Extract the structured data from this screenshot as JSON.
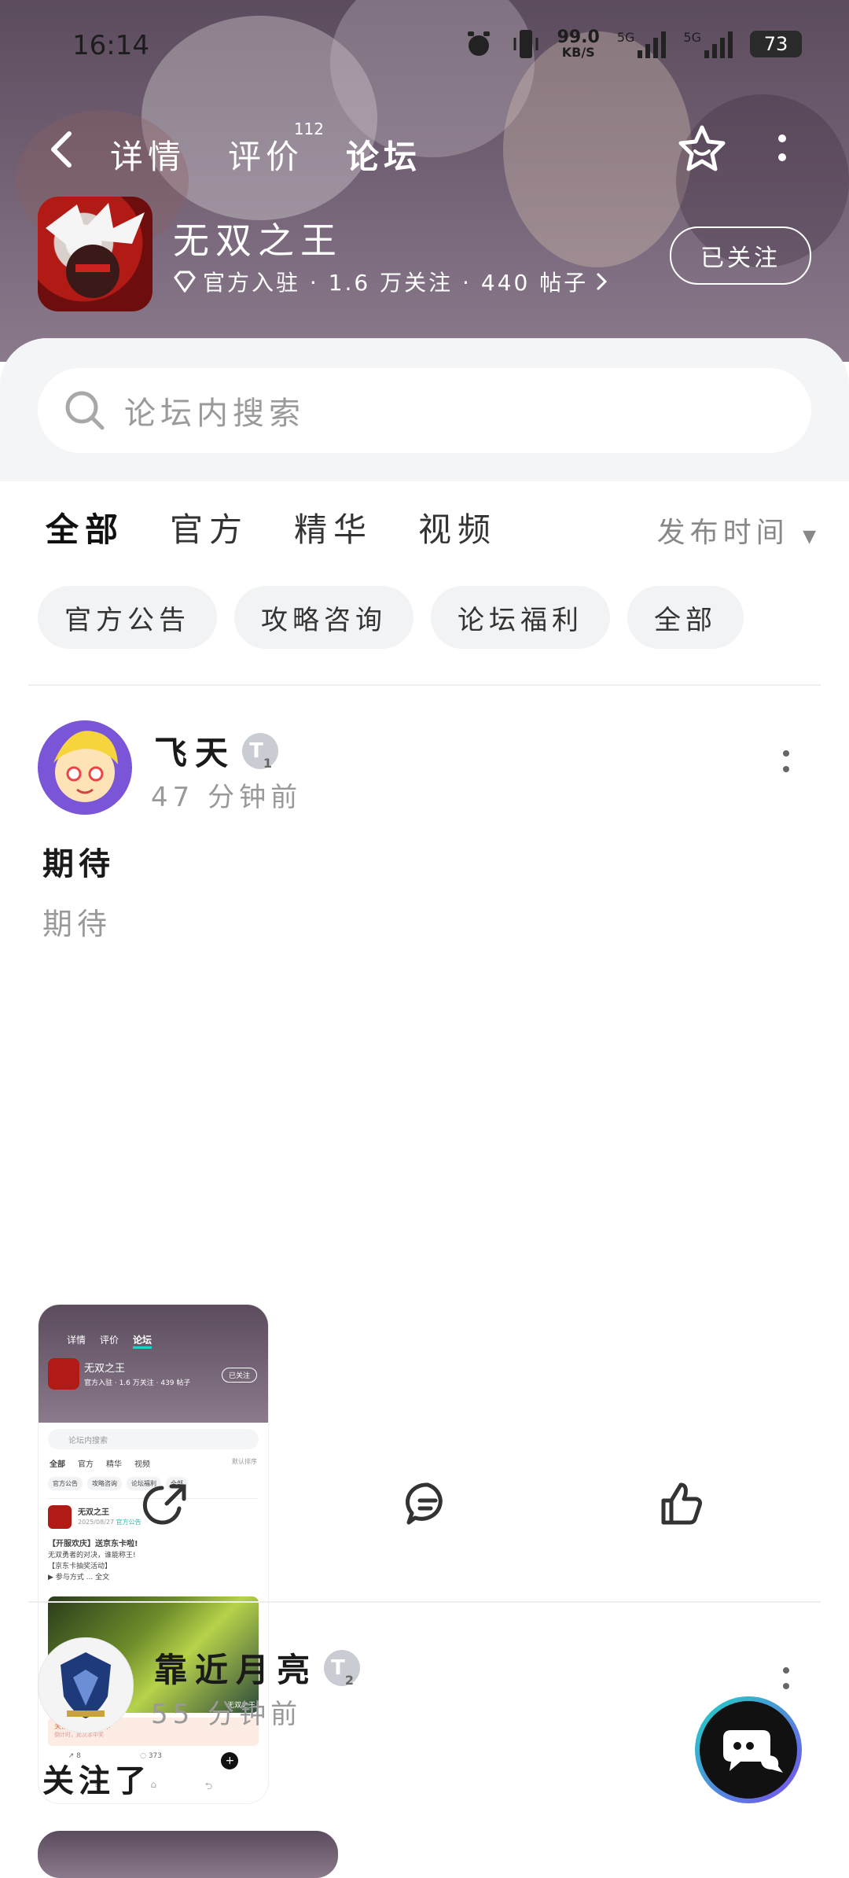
{
  "status": {
    "time": "16:14",
    "net_speed": "99.0",
    "net_unit": "KB/S",
    "sim1": "5G",
    "sim2": "5G",
    "battery": "73"
  },
  "nav": {
    "tabs": [
      {
        "label": "详情"
      },
      {
        "label": "评价",
        "badge": "112"
      },
      {
        "label": "论坛"
      }
    ]
  },
  "game": {
    "title": "无双之王",
    "meta": "官方入驻 · 1.6 万关注 · 440 帖子",
    "follow_label": "已关注"
  },
  "search": {
    "placeholder": "论坛内搜索"
  },
  "filters": {
    "tabs": [
      "全部",
      "官方",
      "精华",
      "视频"
    ],
    "sort": "发布时间"
  },
  "chips": [
    "官方公告",
    "攻略咨询",
    "论坛福利",
    "全部"
  ],
  "posts": [
    {
      "author": "飞天",
      "level": "T",
      "level_num": "1",
      "time": "47 分钟前",
      "title": "期待",
      "body": "期待",
      "screenshot": {
        "tabs": [
          "详情",
          "评价",
          "论坛"
        ],
        "game_title": "无双之王",
        "game_meta": "官方入驻 · 1.6 万关注 · 439 帖子",
        "follow": "已关注",
        "search": "论坛内搜索",
        "filter_tabs": [
          "全部",
          "官方",
          "精华",
          "视频"
        ],
        "sort": "默认排序",
        "chips": [
          "官方公告",
          "攻略咨询",
          "论坛福利",
          "全部"
        ],
        "post_author": "无双之王",
        "post_date": "2025/08/27",
        "post_tag": "官方公告",
        "post_title": "【开服欢庆】送京东卡啦!",
        "post_line1": "无双勇者的对决，谁能称王!",
        "post_line2": "【京东卡抽奖活动】",
        "post_line3": "▶ 参与方式 ... 全文",
        "banner_text": "关注送百元京东卡",
        "banner_sub": "倒计时，此次本中奖",
        "image_caption": "无双之王",
        "shares": "8",
        "comments": "373"
      }
    },
    {
      "author": "靠近月亮",
      "level": "T",
      "level_num": "2",
      "time": "55 分钟前",
      "title": "关注了"
    }
  ]
}
